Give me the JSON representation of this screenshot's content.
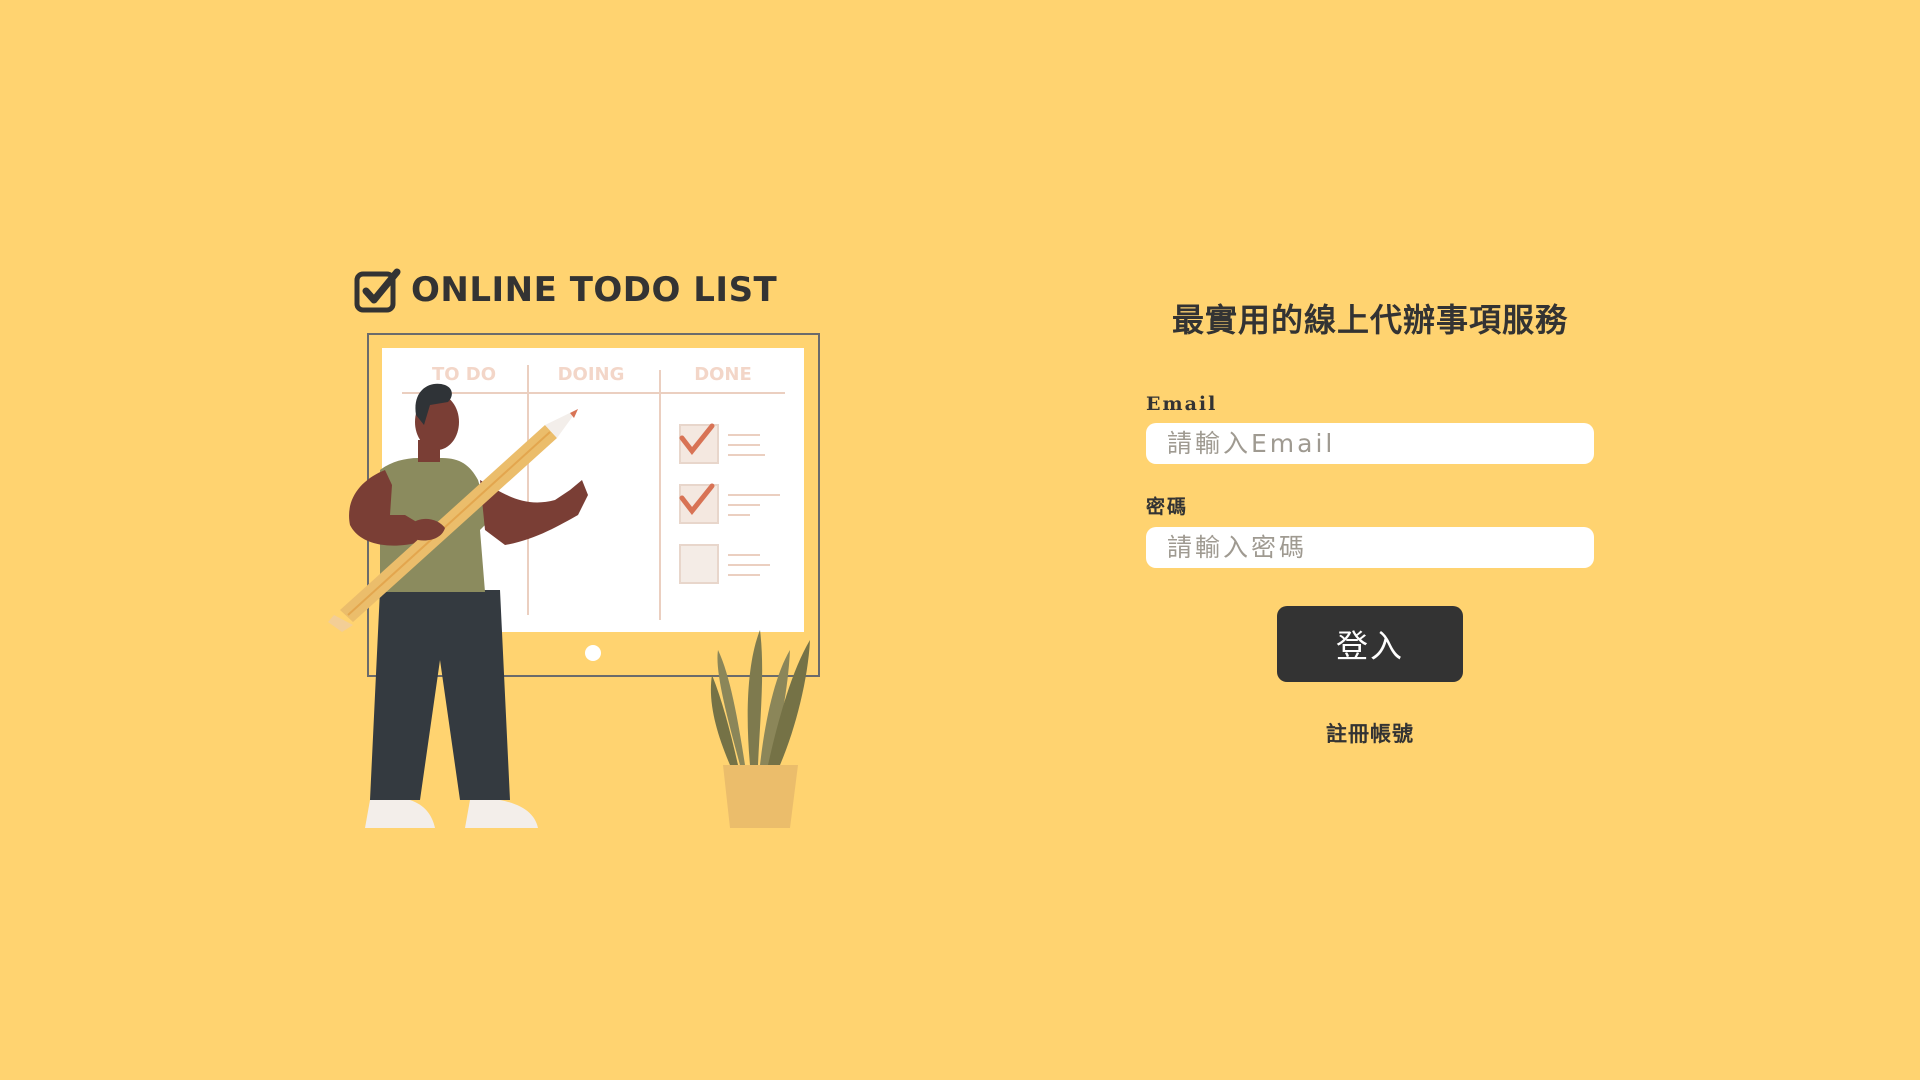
{
  "brand": {
    "logo_text": "ONLINE TODO LIST",
    "icon": "checkbox-icon"
  },
  "illustration": {
    "board_columns": [
      "TO DO",
      "DOING",
      "DONE"
    ]
  },
  "login": {
    "headline": "最實用的線上代辦事項服務",
    "email_label": "Email",
    "email_placeholder": "請輸入Email",
    "email_value": "",
    "password_label": "密碼",
    "password_placeholder": "請輸入密碼",
    "password_value": "",
    "submit_label": "登入",
    "register_label": "註冊帳號"
  },
  "colors": {
    "background": "#FFD370",
    "primary": "#333333",
    "check_red": "#D87355"
  }
}
